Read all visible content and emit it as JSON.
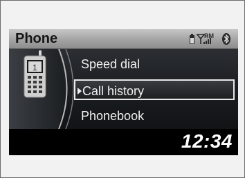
{
  "header": {
    "title": "Phone",
    "roaming_indicator": "RM",
    "battery_icon": "battery-icon",
    "signal_icon": "signal-icon",
    "bluetooth_icon": "bluetooth-icon"
  },
  "menu": {
    "items": [
      {
        "label": "Speed dial",
        "selected": false
      },
      {
        "label": "Call history",
        "selected": true
      },
      {
        "label": "Phonebook",
        "selected": false
      }
    ]
  },
  "phone_graphic": {
    "icon": "cellphone-icon",
    "screen_number": "1"
  },
  "footer": {
    "time": "12:34"
  }
}
